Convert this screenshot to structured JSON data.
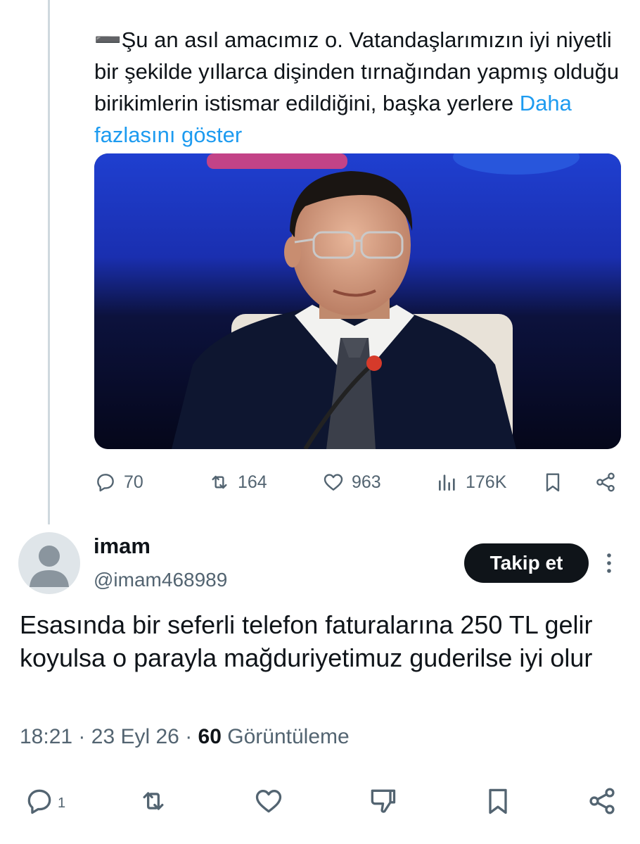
{
  "quoted_tweet": {
    "text": "➖Şu an asıl amacımız o. Vatandaşlarımızın iyi niyetli bir şekilde yıllarca dişinden tırnağından yapmış olduğu birikimlerin istismar edildiğini, başka yerlere ",
    "show_more": "Daha fazlasını göster",
    "stats": {
      "replies": "70",
      "reposts": "164",
      "likes": "963",
      "views": "176K"
    }
  },
  "reply": {
    "display_name": "imam",
    "handle": "@imam468989",
    "follow_label": "Takip et",
    "text": "Esasında bir seferli telefon faturalarına 250 TL gelir koyulsa o parayla mağduriyetimuz guderilse iyi olur",
    "time": "18:21",
    "date": "23 Eyl 26",
    "separator": "·",
    "views_count": "60",
    "views_label": "Görüntüleme",
    "stats": {
      "replies": "1"
    }
  },
  "colors": {
    "accent": "#1d9bf0",
    "text": "#0f1419",
    "muted": "#536471",
    "line": "#cfd9de"
  },
  "icons": [
    "reply-icon",
    "repost-icon",
    "like-icon",
    "views-icon",
    "bookmark-icon",
    "share-icon",
    "more-icon",
    "dislike-icon",
    "default-avatar-icon"
  ]
}
